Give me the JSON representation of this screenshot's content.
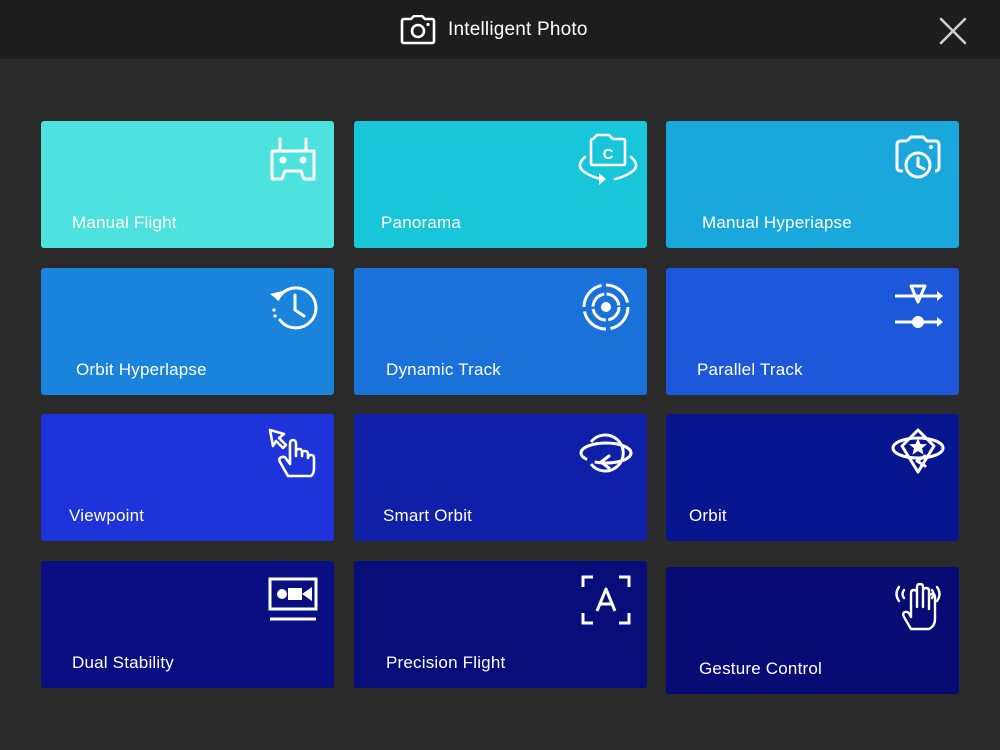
{
  "header": {
    "title": "Intelligent Photo",
    "camera_icon": "camera-icon",
    "close_icon": "close-icon"
  },
  "modes": [
    {
      "label": "Manual Flight",
      "icon": "remote-controller-icon",
      "color": "#4de2dd"
    },
    {
      "label": "Panorama",
      "icon": "panorama-camera-icon",
      "color": "#19c6d9"
    },
    {
      "label": "Manual Hyperiapse",
      "icon": "camera-timer-icon",
      "color": "#1aa8dc"
    },
    {
      "label": "Orbit Hyperlapse",
      "icon": "history-clock-icon",
      "color": "#1a84dc"
    },
    {
      "label": "Dynamic Track",
      "icon": "target-icon",
      "color": "#1b71da"
    },
    {
      "label": "Parallel Track",
      "icon": "parallel-track-icon",
      "color": "#1d58db"
    },
    {
      "label": "Viewpoint",
      "icon": "touch-pointer-icon",
      "color": "#1e33da"
    },
    {
      "label": "Smart Orbit",
      "icon": "orbit-icon",
      "color": "#0f1fa8"
    },
    {
      "label": "Orbit",
      "icon": "orbit-star-icon",
      "color": "#07158f"
    },
    {
      "label": "Dual Stability",
      "icon": "dual-stability-icon",
      "color": "#090f80"
    },
    {
      "label": "Precision Flight",
      "icon": "precision-frame-icon",
      "color": "#070e7a"
    },
    {
      "label": "Gesture Control",
      "icon": "gesture-hand-icon",
      "color": "#060c74"
    }
  ]
}
